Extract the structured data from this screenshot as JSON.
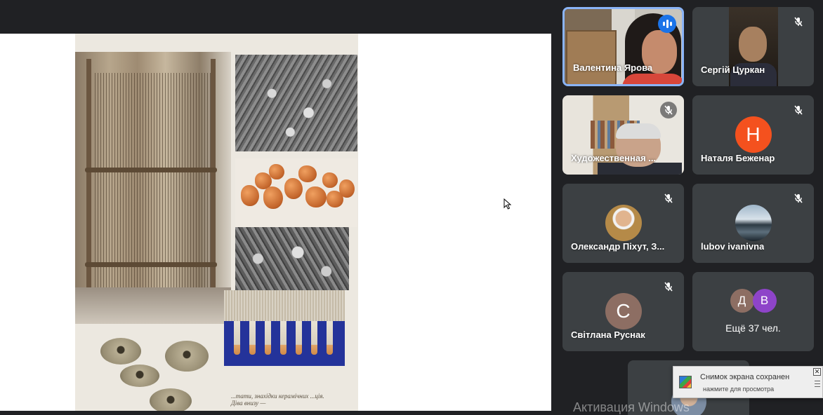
{
  "participants": [
    {
      "id": "valentyna",
      "name": "Валентина Ярова",
      "mic": "speaking"
    },
    {
      "id": "serhii",
      "name": "Сергій Цуркан",
      "mic": "muted"
    },
    {
      "id": "khudozh",
      "name": "Художественная ...",
      "mic": "muted"
    },
    {
      "id": "natalia",
      "name": "Наталя Беженар",
      "mic": "muted",
      "avatar_letter": "Н",
      "avatar_color": "#f4511e"
    },
    {
      "id": "oleksandr",
      "name": "Олександр Піхут, З...",
      "mic": "muted"
    },
    {
      "id": "liubov",
      "name": "lubov ivanivna",
      "mic": "muted"
    },
    {
      "id": "svitlana",
      "name": "Світлана Руснак",
      "mic": "muted",
      "avatar_letter": "С",
      "avatar_color": "#8d6e63"
    }
  ],
  "more": {
    "label": "Ещё 37 чел.",
    "avatars": [
      {
        "letter": "Д",
        "color": "#8d6e63"
      },
      {
        "letter": "В",
        "color": "#8e44c9"
      }
    ]
  },
  "presentation": {
    "caption": "...тати, знахідки керамічних ...ція. Діва внизу —"
  },
  "watermark": "Активация Windows",
  "notification": {
    "title": "Снимок экрана сохранен",
    "subtitle": "нажмите для просмотра"
  },
  "colors": {
    "background": "#202124",
    "tile": "#3c4043",
    "active_border": "#8ab4f8",
    "speaking_indicator": "#1a73e8"
  },
  "icons": {
    "muted": "mic-off-icon",
    "speaking": "speaking-icon",
    "close": "close-icon"
  }
}
